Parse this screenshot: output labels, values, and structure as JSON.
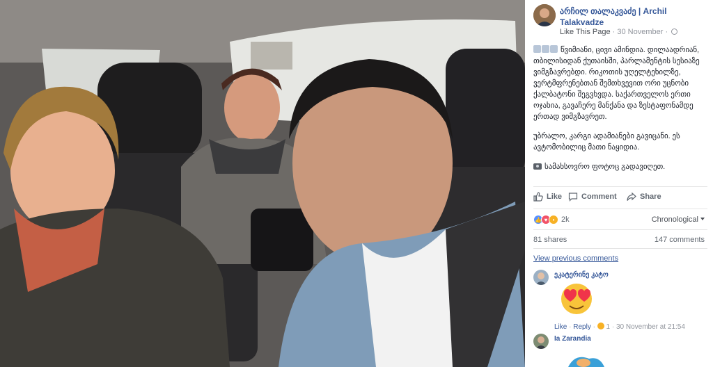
{
  "post": {
    "author": "არჩილ თალაკვაძე | Archil Talakvadze",
    "like_page": "Like This Page",
    "date": "30 November",
    "separator": "·",
    "paragraph_1": "წვიმიანი, ცივი ამინდია. დილაადრიან, თბილისიდან ქუთაისში, პარლამენტის სესიაზე ვიმგზავრებდი. რიკოთის უღელტეხილზე, ვერტმფრენებთან შემთხვევით ორი უცნობი ქალბატონი შეგვხვდა. საქართველოს ერთი ოჯახია, გავაჩერე მანქანა და ზესტაფონამდე ერთად ვიმგზავრეთ.",
    "paragraph_2": "უბრალო, კარგი ადამიანები გავიცანი. ეს ავტომობილიც მათი ნაყიდია.",
    "paragraph_3": "სამახსოვრო ფოტოც გადავიღეთ."
  },
  "actions": {
    "like": "Like",
    "comment": "Comment",
    "share": "Share"
  },
  "stats": {
    "reaction_count": "2k",
    "sort_label": "Chronological",
    "shares": "81 shares",
    "comments": "147 comments"
  },
  "view_previous": "View previous comments",
  "comments": [
    {
      "author": "ეკატერინე კატო",
      "like": "Like",
      "reply": "Reply",
      "reaction_count": "1",
      "time": "30 November at 21:54"
    },
    {
      "author": "Ia Zarandia"
    }
  ],
  "colors": {
    "link_blue": "#365899",
    "like_blue": "#5890ff",
    "love_red": "#f25268",
    "wow_yellow": "#f7b125"
  },
  "icons": [
    "globe-icon",
    "like-icon",
    "comment-icon",
    "share-icon",
    "camera-icon",
    "heart-eyes-emoji"
  ]
}
